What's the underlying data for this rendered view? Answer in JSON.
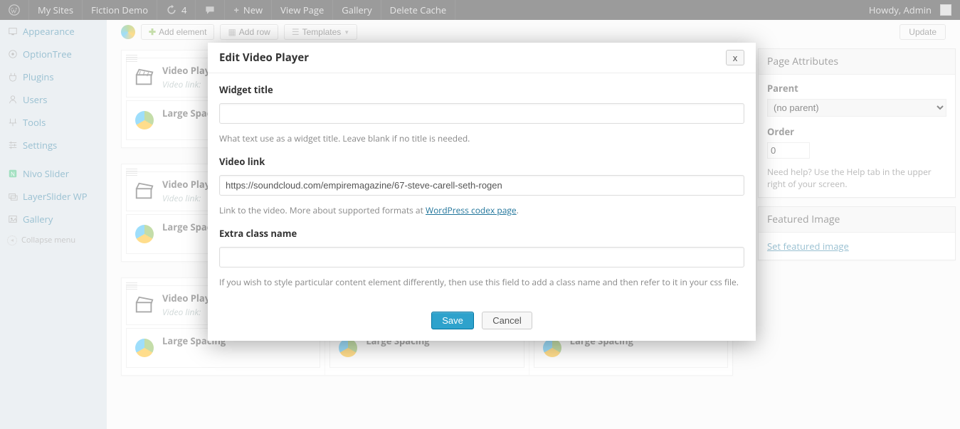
{
  "adminbar": {
    "my_sites": "My Sites",
    "site_name": "Fiction Demo",
    "updates_count": "4",
    "new_label": "New",
    "view_page": "View Page",
    "gallery": "Gallery",
    "delete_cache": "Delete Cache",
    "howdy": "Howdy, Admin"
  },
  "sidebar": {
    "items": [
      {
        "label": "Appearance"
      },
      {
        "label": "OptionTree"
      },
      {
        "label": "Plugins"
      },
      {
        "label": "Users"
      },
      {
        "label": "Tools"
      },
      {
        "label": "Settings"
      },
      {
        "label": "Nivo Slider"
      },
      {
        "label": "LayerSlider WP"
      },
      {
        "label": "Gallery"
      }
    ],
    "collapse": "Collapse menu"
  },
  "toolbar": {
    "add_element": "Add element",
    "add_row": "Add row",
    "templates": "Templates",
    "update": "Update"
  },
  "widgets": {
    "video_player_title": "Video Player",
    "video_link_prefix": "Video link:",
    "large_spacing": "Large Spacing"
  },
  "rightcol": {
    "attributes_title": "Page Attributes",
    "parent_label": "Parent",
    "parent_value": "(no parent)",
    "order_label": "Order",
    "order_value": "0",
    "help_text": "Need help? Use the Help tab in the upper right of your screen.",
    "featured_title": "Featured Image",
    "set_featured": "Set featured image"
  },
  "modal": {
    "title": "Edit Video Player",
    "close": "x",
    "widget_title_label": "Widget title",
    "widget_title_value": "",
    "widget_title_desc": "What text use as a widget title. Leave blank if no title is needed.",
    "video_link_label": "Video link",
    "video_link_value": "https://soundcloud.com/empiremagazine/67-steve-carell-seth-rogen",
    "video_link_desc_pre": "Link to the video. More about supported formats at ",
    "video_link_desc_link": "WordPress codex page",
    "extra_class_label": "Extra class name",
    "extra_class_value": "",
    "extra_class_desc": "If you wish to style particular content element differently, then use this field to add a class name and then refer to it in your css file.",
    "save": "Save",
    "cancel": "Cancel"
  }
}
